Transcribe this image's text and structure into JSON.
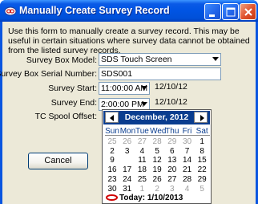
{
  "window": {
    "title": "Manually Create Survey Record",
    "intro_text": "Use this form to manually create a survey record.  This may be useful in certain situations where survey data cannot be obtained from the listed survey records."
  },
  "form": {
    "model_label": "Survey Box Model:",
    "model_value": "SDS Touch Screen",
    "serial_label": "Survey Box Serial Number:",
    "serial_value": "SDS001",
    "start_label": "Survey Start:",
    "start_time": "11:00:00 AM",
    "start_date": "12/10/12",
    "end_label": "Survey End:",
    "end_time": "2:00:00 PM",
    "end_date": "12/10/12",
    "spool_label": "TC Spool Offset:"
  },
  "buttons": {
    "cancel": "Cancel"
  },
  "calendar": {
    "month_label": "December, 2012",
    "days_of_week": [
      "Sun",
      "Mon",
      "Tue",
      "Wed",
      "Thu",
      "Fri",
      "Sat"
    ],
    "weeks": [
      [
        "25",
        "26",
        "27",
        "28",
        "29",
        "30",
        "1"
      ],
      [
        "2",
        "3",
        "4",
        "5",
        "6",
        "7",
        "8"
      ],
      [
        "9",
        "10",
        "11",
        "12",
        "13",
        "14",
        "15"
      ],
      [
        "16",
        "17",
        "18",
        "19",
        "20",
        "21",
        "22"
      ],
      [
        "23",
        "24",
        "25",
        "26",
        "27",
        "28",
        "29"
      ],
      [
        "30",
        "31",
        "1",
        "2",
        "3",
        "4",
        "5"
      ]
    ],
    "selected_day": "10",
    "today_text": "Today: 1/10/2013"
  }
}
